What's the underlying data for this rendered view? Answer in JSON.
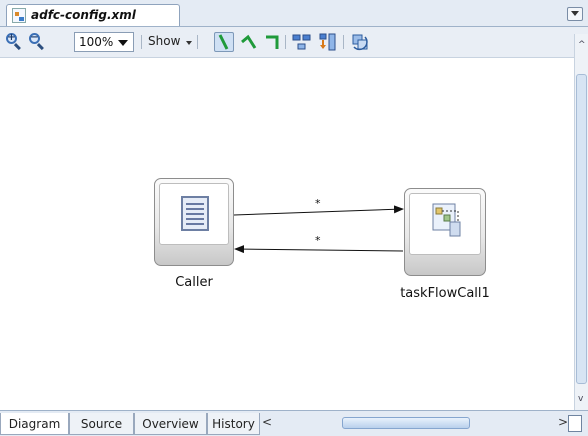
{
  "editor": {
    "file_tab": {
      "label": "adfc-config.xml",
      "icon": "adfc-config-file-icon"
    },
    "tab_list_icon": "chevron-down-icon"
  },
  "toolbar": {
    "zoom_in_icon": "zoom-in-icon",
    "zoom_out_icon": "zoom-out-icon",
    "zoom_value": "100%",
    "show_label": "Show",
    "buttons": [
      {
        "icon": "straight-line-icon",
        "selected": true
      },
      {
        "icon": "polyline-icon",
        "selected": false
      },
      {
        "icon": "orthogonal-line-icon",
        "selected": false
      },
      {
        "icon": "layout-horizontal-icon",
        "selected": false
      },
      {
        "icon": "layout-vertical-icon",
        "selected": false
      },
      {
        "icon": "refresh-icon",
        "selected": false
      }
    ]
  },
  "diagram": {
    "nodes": [
      {
        "label": "Caller",
        "icon": "view-page-icon"
      },
      {
        "label": "taskFlowCall1",
        "icon": "task-flow-call-icon"
      }
    ],
    "edges": [
      {
        "from": "Caller",
        "to": "taskFlowCall1",
        "label": "*"
      },
      {
        "from": "taskFlowCall1",
        "to": "Caller",
        "label": "*"
      }
    ]
  },
  "bottom_tabs": [
    {
      "label": "Diagram",
      "active": true
    },
    {
      "label": "Source",
      "active": false
    },
    {
      "label": "Overview",
      "active": false
    },
    {
      "label": "History",
      "active": false
    }
  ],
  "colors": {
    "tab_strip": "#e4ebf4",
    "toolbar": "#e9eef5",
    "accent_green": "#1f9a3a"
  }
}
